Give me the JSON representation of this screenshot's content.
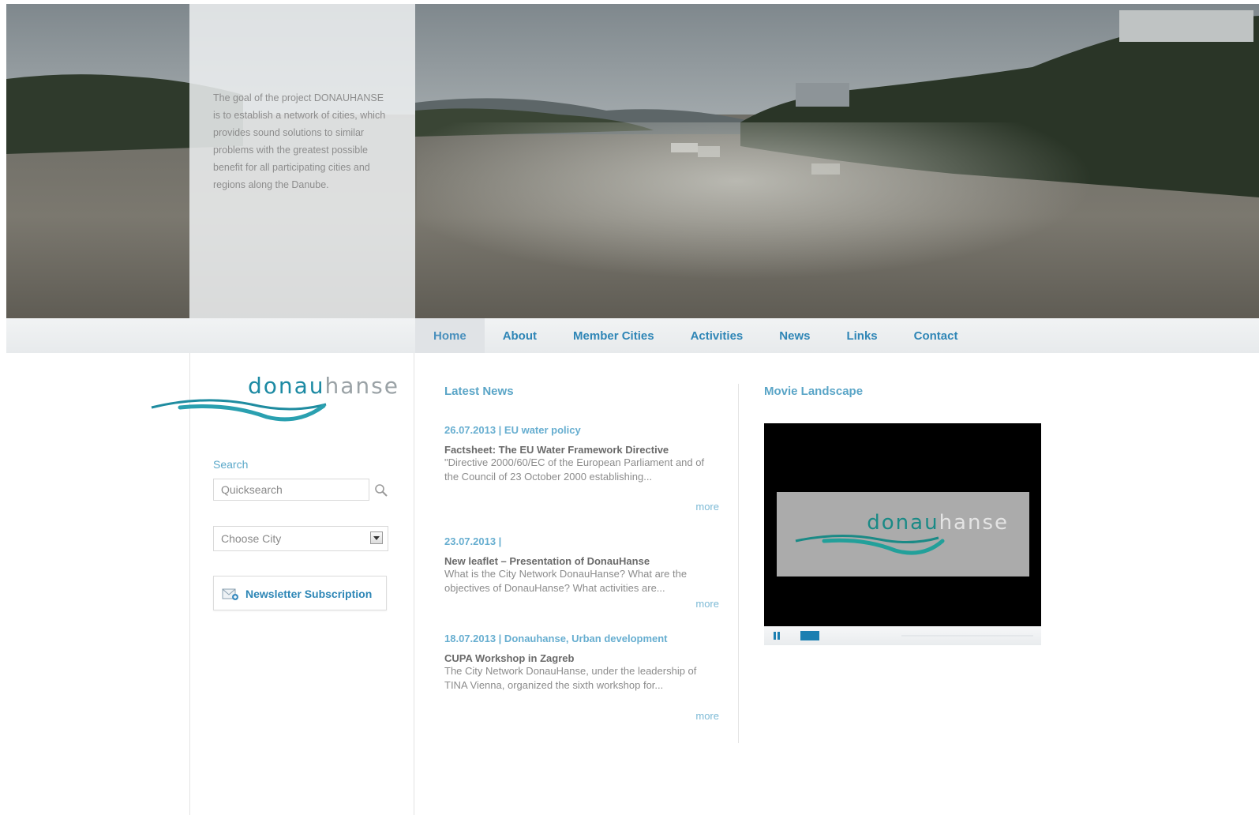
{
  "hero": {
    "intro": "The goal of the project DONAUHANSE is to establish a network of cities, which provides sound solutions to similar problems with the greatest possible benefit for all participating cities and regions along the Danube."
  },
  "nav": {
    "items": [
      {
        "label": "Home",
        "active": true
      },
      {
        "label": "About"
      },
      {
        "label": "Member Cities"
      },
      {
        "label": "Activities"
      },
      {
        "label": "News"
      },
      {
        "label": "Links"
      },
      {
        "label": "Contact"
      }
    ]
  },
  "logo": {
    "part1": "donau",
    "part2": "hanse"
  },
  "sidebar": {
    "search_label": "Search",
    "search_placeholder": "Quicksearch",
    "city_select": "Choose City",
    "newsletter": "Newsletter Subscription"
  },
  "news": {
    "title": "Latest News",
    "items": [
      {
        "meta": "26.07.2013 | EU water policy",
        "title": "Factsheet: The EU Water Framework Directive",
        "text": "\"Directive 2000/60/EC of the European Parliament and of the Council of 23 October 2000 establishing...",
        "more": "more"
      },
      {
        "meta": "23.07.2013 |",
        "title": "New leaflet – Presentation of DonauHanse",
        "text": "What is the City Network DonauHanse? What are the objectives of DonauHanse? What activities are...",
        "more": "more"
      },
      {
        "meta": "18.07.2013 | Donauhanse, Urban development",
        "title": "CUPA Workshop in Zagreb",
        "text": "The City Network DonauHanse, under the leadership of TINA Vienna, organized the sixth workshop for...",
        "more": "more"
      }
    ]
  },
  "movie": {
    "title": "Movie Landscape",
    "logo_part1": "donau",
    "logo_part2": "hanse",
    "progress": 0.08
  },
  "colors": {
    "link_blue": "#2f86b6",
    "heading_blue": "#5aa5c7",
    "brand_teal": "#1c8aa3"
  }
}
